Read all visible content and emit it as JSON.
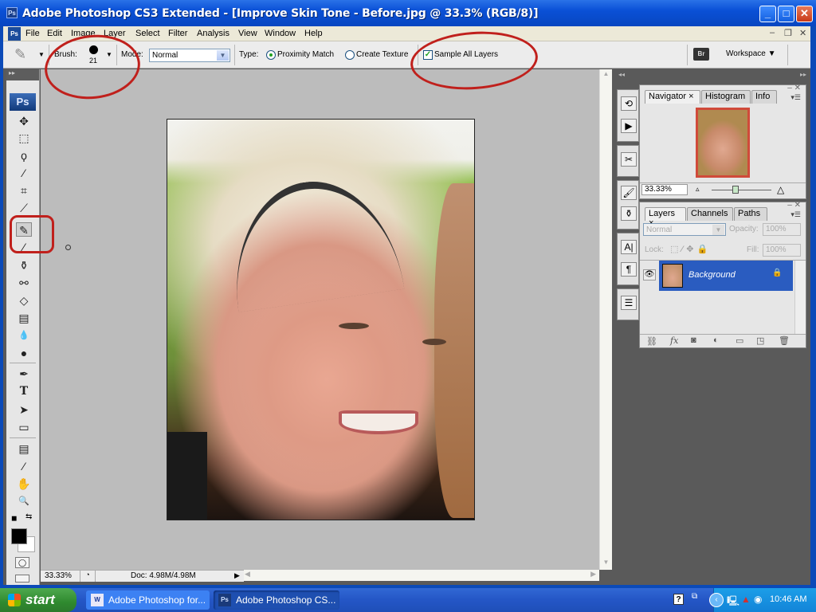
{
  "window": {
    "app_icon": "Ps",
    "title": "Adobe Photoshop CS3 Extended - [Improve Skin Tone - Before.jpg @ 33.3% (RGB/8)]",
    "controls": {
      "minimize": "_",
      "maximize": "□",
      "close": "✕"
    }
  },
  "menu": {
    "items": [
      "File",
      "Edit",
      "Image",
      "Layer",
      "Select",
      "Filter",
      "Analysis",
      "View",
      "Window",
      "Help"
    ],
    "doc_controls": {
      "minimize": "–",
      "restore": "❐",
      "close": "✕"
    }
  },
  "options_bar": {
    "brush_label": "Brush:",
    "brush_size": "21",
    "mode_label": "Mode:",
    "mode_value": "Normal",
    "type_label": "Type:",
    "type_options": [
      {
        "label": "Proximity Match",
        "selected": true
      },
      {
        "label": "Create Texture",
        "selected": false
      }
    ],
    "sample_all_layers_label": "Sample All Layers",
    "sample_all_layers_checked": true,
    "workspace_label": "Workspace ▼",
    "bridge_label": "Br"
  },
  "toolbox": {
    "header": "▸▸",
    "logo": "Ps",
    "tools": [
      {
        "name": "move-tool",
        "glyph": "✥"
      },
      {
        "name": "marquee-tool",
        "glyph": "⬚"
      },
      {
        "name": "lasso-tool",
        "glyph": "ϙ"
      },
      {
        "name": "magic-wand-tool",
        "glyph": "⁄"
      },
      {
        "name": "crop-tool",
        "glyph": "⌗"
      },
      {
        "name": "slice-tool",
        "glyph": "⟋"
      },
      {
        "name": "spot-healing-brush-tool",
        "glyph": "✎",
        "active": true
      },
      {
        "name": "brush-tool",
        "glyph": "⁄"
      },
      {
        "name": "clone-stamp-tool",
        "glyph": "⚱"
      },
      {
        "name": "history-brush-tool",
        "glyph": "⚯"
      },
      {
        "name": "eraser-tool",
        "glyph": "◇"
      },
      {
        "name": "gradient-tool",
        "glyph": "▤"
      },
      {
        "name": "blur-tool",
        "glyph": "💧"
      },
      {
        "name": "dodge-tool",
        "glyph": "●"
      },
      {
        "name": "pen-tool",
        "glyph": "✒"
      },
      {
        "name": "type-tool",
        "glyph": "T"
      },
      {
        "name": "path-selection-tool",
        "glyph": "➤"
      },
      {
        "name": "shape-tool",
        "glyph": "▭"
      },
      {
        "name": "notes-tool",
        "glyph": "▤"
      },
      {
        "name": "eyedropper-tool",
        "glyph": "⁄"
      },
      {
        "name": "hand-tool",
        "glyph": "✋"
      },
      {
        "name": "zoom-tool",
        "glyph": "🔍"
      }
    ],
    "default_colors_glyph": "◼",
    "swap_colors_glyph": "⇆",
    "foreground_color": "#000000",
    "background_color": "#ffffff",
    "quick_mask_glyph": "◯",
    "screen_mode_glyph": "▭"
  },
  "status_bar": {
    "zoom": "33.33%",
    "doc_info": "Doc: 4.98M/4.98M",
    "arrow": "▶"
  },
  "dock": {
    "header_collapse": "◂◂",
    "header_expand": "▸▸",
    "strip_icons": [
      {
        "name": "history-icon",
        "glyph": "⟲"
      },
      {
        "name": "actions-icon",
        "glyph": "▶"
      },
      {
        "name": "tool-presets-icon",
        "glyph": "✂"
      },
      {
        "name": "brushes-icon",
        "glyph": "🖌"
      },
      {
        "name": "clone-source-icon",
        "glyph": "⚱"
      },
      {
        "name": "character-icon",
        "glyph": "A|"
      },
      {
        "name": "paragraph-icon",
        "glyph": "¶"
      },
      {
        "name": "layer-comps-icon",
        "glyph": "☰"
      }
    ]
  },
  "navigator_panel": {
    "tabs": [
      {
        "label": "Navigator",
        "active": true,
        "closable": true
      },
      {
        "label": "Histogram",
        "active": false
      },
      {
        "label": "Info",
        "active": false
      }
    ],
    "zoom_value": "33.33%",
    "zoom_slider_fraction": 0.4
  },
  "layers_panel": {
    "tabs": [
      {
        "label": "Layers",
        "active": true,
        "closable": true
      },
      {
        "label": "Channels",
        "active": false
      },
      {
        "label": "Paths",
        "active": false
      }
    ],
    "blend_mode": "Normal",
    "opacity_label": "Opacity:",
    "opacity_value": "100%",
    "lock_label": "Lock:",
    "fill_label": "Fill:",
    "fill_value": "100%",
    "layers": [
      {
        "name": "Background",
        "visible": true,
        "locked": true,
        "selected": true
      }
    ],
    "bottom_icons": [
      "link-layers",
      "fx",
      "add-mask",
      "adjustment-layer",
      "new-group",
      "new-layer",
      "delete-layer"
    ],
    "fx_label": "fx"
  },
  "taskbar": {
    "start_label": "start",
    "items": [
      {
        "label": "Adobe Photoshop for...",
        "icon": "W",
        "active": false
      },
      {
        "label": "Adobe Photoshop CS...",
        "icon": "Ps",
        "active": true
      }
    ],
    "clock": "10:46 AM"
  },
  "annotations": {
    "highlight_color": "#c0201c"
  }
}
